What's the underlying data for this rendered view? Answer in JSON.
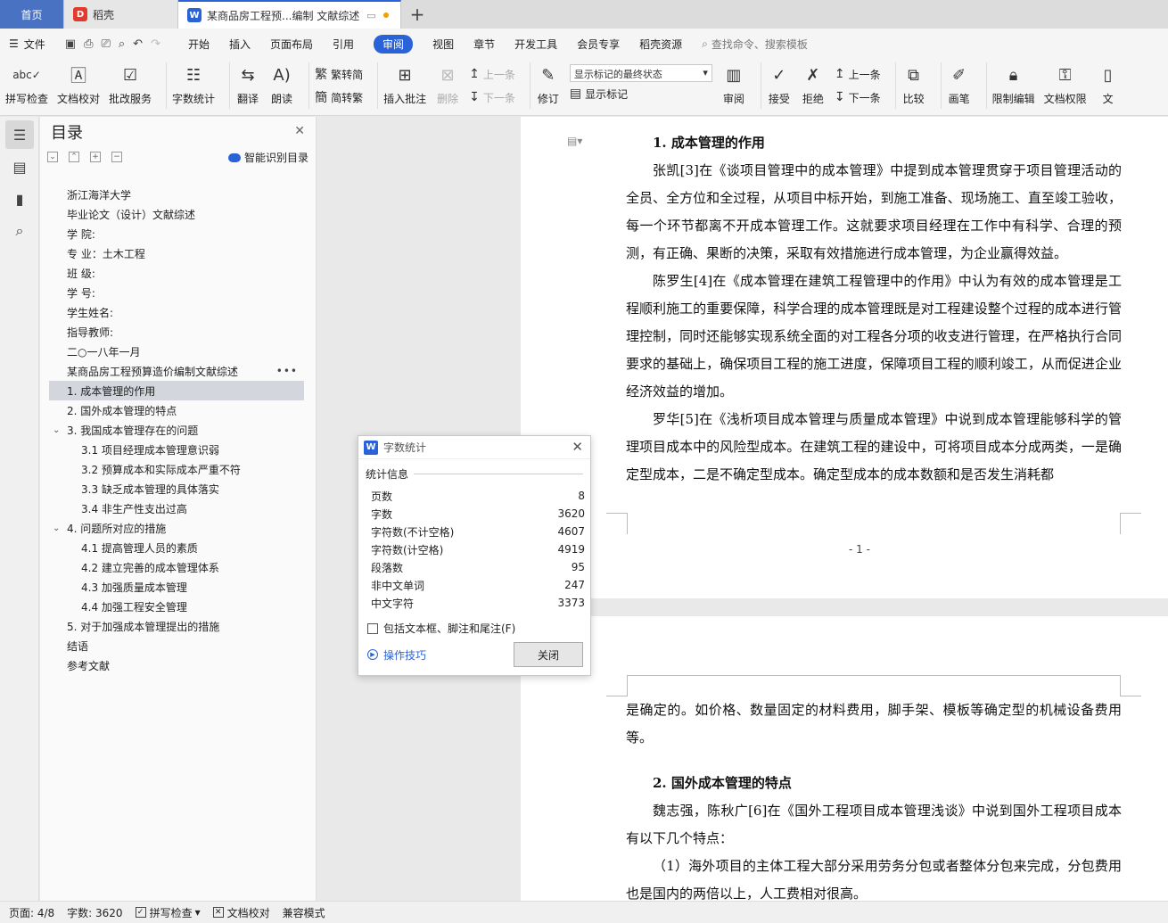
{
  "tabs": {
    "home": "首页",
    "daoke": "稻壳",
    "doc": "某商品房工程预...编制 文献综述"
  },
  "menu": {
    "file": "文件",
    "items": [
      "开始",
      "插入",
      "页面布局",
      "引用",
      "审阅",
      "视图",
      "章节",
      "开发工具",
      "会员专享",
      "稻壳资源"
    ],
    "active": "审阅",
    "search": "查找命令、搜索模板"
  },
  "ribbon": {
    "spell": "拼写检查",
    "proof": "文档校对",
    "annotate_service": "批改服务",
    "word_count": "字数统计",
    "translate": "翻译",
    "read_aloud": "朗读",
    "to_trad": "繁转简",
    "to_simp": "简转繁",
    "insert_comment": "插入批注",
    "delete": "删除",
    "prev": "上一条",
    "next": "下一条",
    "revise": "修订",
    "markup_select": "显示标记的最终状态",
    "show_markup": "显示标记",
    "review": "审阅",
    "accept": "接受",
    "reject": "拒绝",
    "prev2": "上一条",
    "next2": "下一条",
    "compare": "比较",
    "pen": "画笔",
    "restrict_edit": "限制编辑",
    "doc_permission": "文档权限",
    "doc_cut": "文"
  },
  "toc": {
    "title": "目录",
    "smart": "智能识别目录",
    "items": [
      {
        "text": "浙江海洋大学",
        "level": 0
      },
      {
        "text": "毕业论文（设计）文献综述",
        "level": 0
      },
      {
        "text": "学      院:",
        "level": 0
      },
      {
        "text": "专      业：土木工程",
        "level": 0
      },
      {
        "text": "班      级:",
        "level": 0
      },
      {
        "text": "学      号:",
        "level": 0
      },
      {
        "text": "学生姓名:",
        "level": 0
      },
      {
        "text": "指导教师:",
        "level": 0
      },
      {
        "text": "二○一八年一月",
        "level": 0
      },
      {
        "text": "某商品房工程预算造价编制文献综述",
        "level": 0
      },
      {
        "text": "1.  成本管理的作用",
        "level": 1
      },
      {
        "text": "2.  国外成本管理的特点",
        "level": 1
      },
      {
        "text": "3.  我国成本管理存在的问题",
        "level": 1
      },
      {
        "text": "3.1 项目经理成本管理意识弱",
        "level": 2
      },
      {
        "text": "3.2 预算成本和实际成本严重不符",
        "level": 2
      },
      {
        "text": "3.3 缺乏成本管理的具体落实",
        "level": 2
      },
      {
        "text": "3.4  非生产性支出过高",
        "level": 2
      },
      {
        "text": "4.  问题所对应的措施",
        "level": 1
      },
      {
        "text": "4.1 提高管理人员的素质",
        "level": 2
      },
      {
        "text": "4.2 建立完善的成本管理体系",
        "level": 2
      },
      {
        "text": "4.3  加强质量成本管理",
        "level": 2
      },
      {
        "text": "4.4 加强工程安全管理",
        "level": 2
      },
      {
        "text": "5.  对于加强成本管理提出的措施",
        "level": 1
      },
      {
        "text": "结语",
        "level": 0
      },
      {
        "text": "参考文献",
        "level": 0
      }
    ]
  },
  "document": {
    "h1": "1.  成本管理的作用",
    "p1": "张凯[3]在《谈项目管理中的成本管理》中提到成本管理贯穿于项目管理活动的全员、全方位和全过程，从项目中标开始，到施工准备、现场施工、直至竣工验收，每一个环节都离不开成本管理工作。这就要求项目经理在工作中有科学、合理的预测，有正确、果断的决策，采取有效措施进行成本管理，为企业赢得效益。",
    "p2": "陈罗生[4]在《成本管理在建筑工程管理中的作用》中认为有效的成本管理是工程顺利施工的重要保障，科学合理的成本管理既是对工程建设整个过程的成本进行管理控制，同时还能够实现系统全面的对工程各分项的收支进行管理，在严格执行合同要求的基础上，确保项目工程的施工进度，保障项目工程的顺利竣工，从而促进企业经济效益的增加。",
    "p3": "罗华[5]在《浅析项目成本管理与质量成本管理》中说到成本管理能够科学的管理项目成本中的风险型成本。在建筑工程的建设中，可将项目成本分成两类，一是确定型成本，二是不确定型成本。确定型成本的成本数额和是否发生消耗都",
    "page_num": "- 1 -",
    "p4": "是确定的。如价格、数量固定的材料费用，脚手架、模板等确定型的机械设备费用等。",
    "h2": "2.  国外成本管理的特点",
    "p5": "魏志强，陈秋广[6]在《国外工程项目成本管理浅谈》中说到国外工程项目成本有以下几个特点：",
    "p6": "（1）海外项目的主体工程大部分采用劳务分包或者整体分包来完成，分包费用也是国内的两倍以上，人工费相对很高。"
  },
  "dialog": {
    "title": "字数统计",
    "group": "统计信息",
    "rows": [
      {
        "label": "页数",
        "value": "8"
      },
      {
        "label": "字数",
        "value": "3620"
      },
      {
        "label": "字符数(不计空格)",
        "value": "4607"
      },
      {
        "label": "字符数(计空格)",
        "value": "4919"
      },
      {
        "label": "段落数",
        "value": "95"
      },
      {
        "label": "非中文单词",
        "value": "247"
      },
      {
        "label": "中文字符",
        "value": "3373"
      }
    ],
    "include": "包括文本框、脚注和尾注(F)",
    "tips": "操作技巧",
    "close": "关闭"
  },
  "status": {
    "page": "页面: 4/8",
    "words": "字数: 3620",
    "spell": "拼写检查",
    "proof": "文档校对",
    "compat": "兼容模式"
  }
}
